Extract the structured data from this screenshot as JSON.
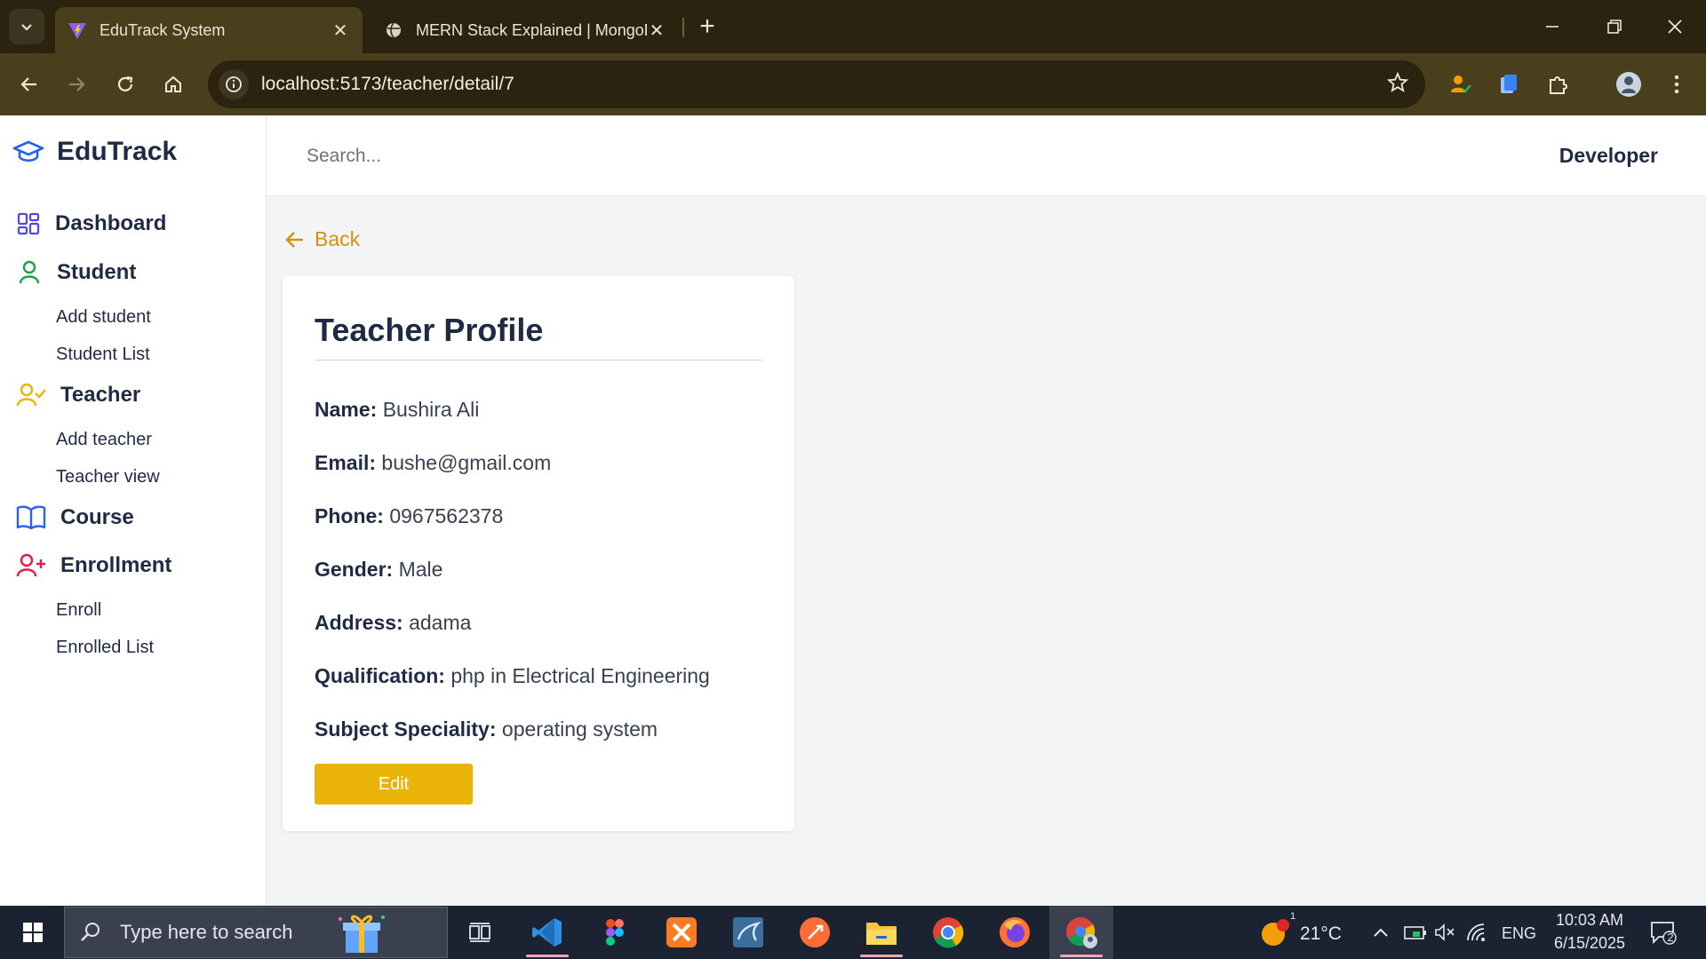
{
  "browser": {
    "tabs": [
      {
        "title": "EduTrack System",
        "active": true
      },
      {
        "title": "MERN Stack Explained | MongoDB",
        "active": false
      }
    ],
    "url": "localhost:5173/teacher/detail/7"
  },
  "sidebar": {
    "brand": "EduTrack",
    "sections": {
      "dashboard": "Dashboard",
      "student": "Student",
      "add_student": "Add student",
      "student_list": "Student List",
      "teacher": "Teacher",
      "add_teacher": "Add teacher",
      "teacher_view": "Teacher view",
      "course": "Course",
      "enrollment": "Enrollment",
      "enroll": "Enroll",
      "enrolled_list": "Enrolled List"
    },
    "icon_colors": {
      "dashboard": "#4f46e5",
      "student": "#16a34a",
      "teacher": "#eab308",
      "course": "#2563eb",
      "enrollment": "#e11d48"
    }
  },
  "header": {
    "search_placeholder": "Search...",
    "user_role": "Developer"
  },
  "main": {
    "back_label": "Back",
    "card_title": "Teacher Profile",
    "fields": [
      {
        "label": "Name:",
        "value": "Bushira Ali"
      },
      {
        "label": "Email:",
        "value": "bushe@gmail.com"
      },
      {
        "label": "Phone:",
        "value": "0967562378"
      },
      {
        "label": "Gender:",
        "value": "Male"
      },
      {
        "label": "Address:",
        "value": "adama"
      },
      {
        "label": "Qualification:",
        "value": "php in Electrical Engineering"
      },
      {
        "label": "Subject Speciality:",
        "value": "operating system"
      }
    ],
    "edit_label": "Edit",
    "accent_color": "#eab308"
  },
  "taskbar": {
    "search_placeholder": "Type here to search",
    "weather": "21°C",
    "weather_badge": "1",
    "language": "ENG",
    "time": "10:03 AM",
    "date": "6/15/2025",
    "notifications": "2"
  }
}
